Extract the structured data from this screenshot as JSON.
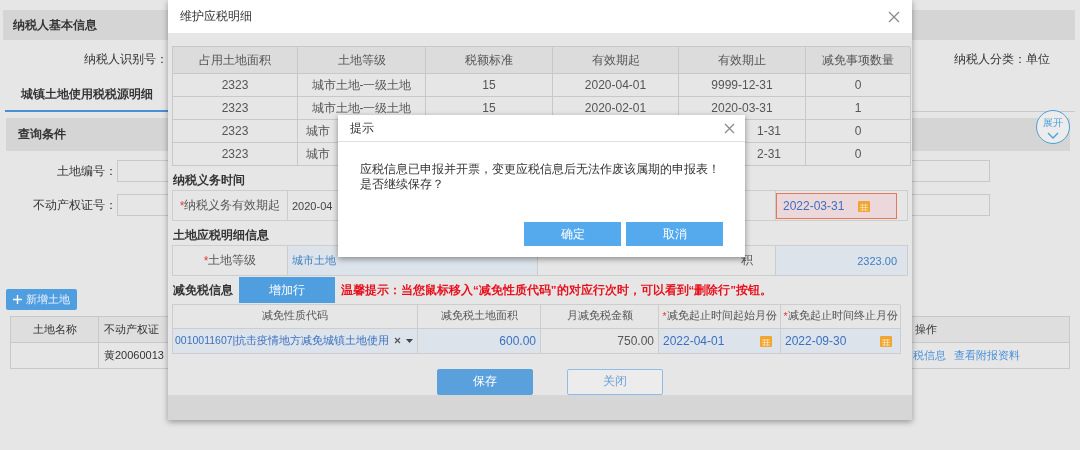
{
  "page": {
    "header": "纳税人基本信息",
    "taxpayer_id_label": "纳税人识别号：",
    "taxpayer_type": "纳税人分类：单位",
    "tabs": [
      {
        "label": "城镇土地使用税税源明细",
        "selected": true
      }
    ],
    "query": {
      "title": "查询条件",
      "expand_button": "展开",
      "fields": [
        {
          "label": "土地编号："
        },
        {
          "label": "不动产权证号："
        }
      ]
    },
    "add_button": "新增土地",
    "table": {
      "columns": [
        "土地名称",
        "不动产权证",
        "操作"
      ],
      "rows": [
        {
          "certificate": "黄20060013",
          "actions": [
            "税信息",
            "查看附报资料"
          ]
        }
      ]
    }
  },
  "modal": {
    "title": "维护应税明细",
    "table": {
      "columns": [
        "占用土地面积",
        "土地等级",
        "税额标准",
        "有效期起",
        "有效期止",
        "减免事项数量"
      ],
      "rows": [
        {
          "cells": [
            {
              "text": "2323"
            },
            {
              "text": "城市土地-一级土地"
            },
            {
              "text": "15"
            },
            {
              "text": "2020-04-01"
            },
            {
              "text": "9999-12-31"
            },
            {
              "text": "0"
            }
          ]
        },
        {
          "cells": [
            {
              "text": "2323"
            },
            {
              "text": "城市土地-一级土地"
            },
            {
              "text": "15"
            },
            {
              "text": "2020-02-01"
            },
            {
              "text": "2020-03-31"
            },
            {
              "text": "1"
            }
          ]
        },
        {
          "cells": [
            {
              "text": "2323"
            },
            {
              "text": "城市"
            },
            null,
            null,
            {
              "text": "1-31"
            },
            {
              "text": "0"
            }
          ]
        },
        {
          "cells": [
            {
              "text": "2323"
            },
            {
              "text": "城市"
            },
            null,
            null,
            {
              "text": "2-31"
            },
            {
              "text": "0"
            }
          ]
        }
      ]
    },
    "duty_section": {
      "title": "纳税义务时间",
      "mark": "*",
      "label": "纳税义务有效期起",
      "value": "2020-04",
      "date_value": "2022-03-31",
      "date_invalid": true
    },
    "land_section": {
      "title": "土地应税明细信息",
      "mark": "*",
      "label": "土地等级",
      "value": "城市土地",
      "label_2": "积",
      "value_2": "2323.00"
    },
    "exemption": {
      "title": "减免税信息",
      "add_row_button": "增加行",
      "notice": "温馨提示：当您鼠标移入“减免性质代码”的对应行次时，可以看到“删除行”按钮。",
      "columns": [
        {
          "label": "减免性质代码"
        },
        {
          "label": "减免税土地面积"
        },
        {
          "label": "月减免税金额"
        },
        {
          "mark": "*",
          "label": "减免起止时间起始月份"
        },
        {
          "mark": "*",
          "label": "减免起止时间终止月份"
        }
      ],
      "rows": [
        {
          "code": "0010011607|抗击疫情地方减免城镇土地使用",
          "area": "600.00",
          "amount": "750.00",
          "start": "2022-04-01",
          "end": "2022-09-30"
        }
      ]
    },
    "buttons": [
      {
        "label": "保存",
        "kind": "primary"
      },
      {
        "label": "关闭",
        "kind": "secondary"
      }
    ]
  },
  "dialog": {
    "title": "提示",
    "lines": [
      "应税信息已申报并开票，变更应税信息后无法作废该属期的申报表！",
      "是否继续保存？"
    ],
    "buttons": [
      "确定",
      "取消"
    ]
  }
}
